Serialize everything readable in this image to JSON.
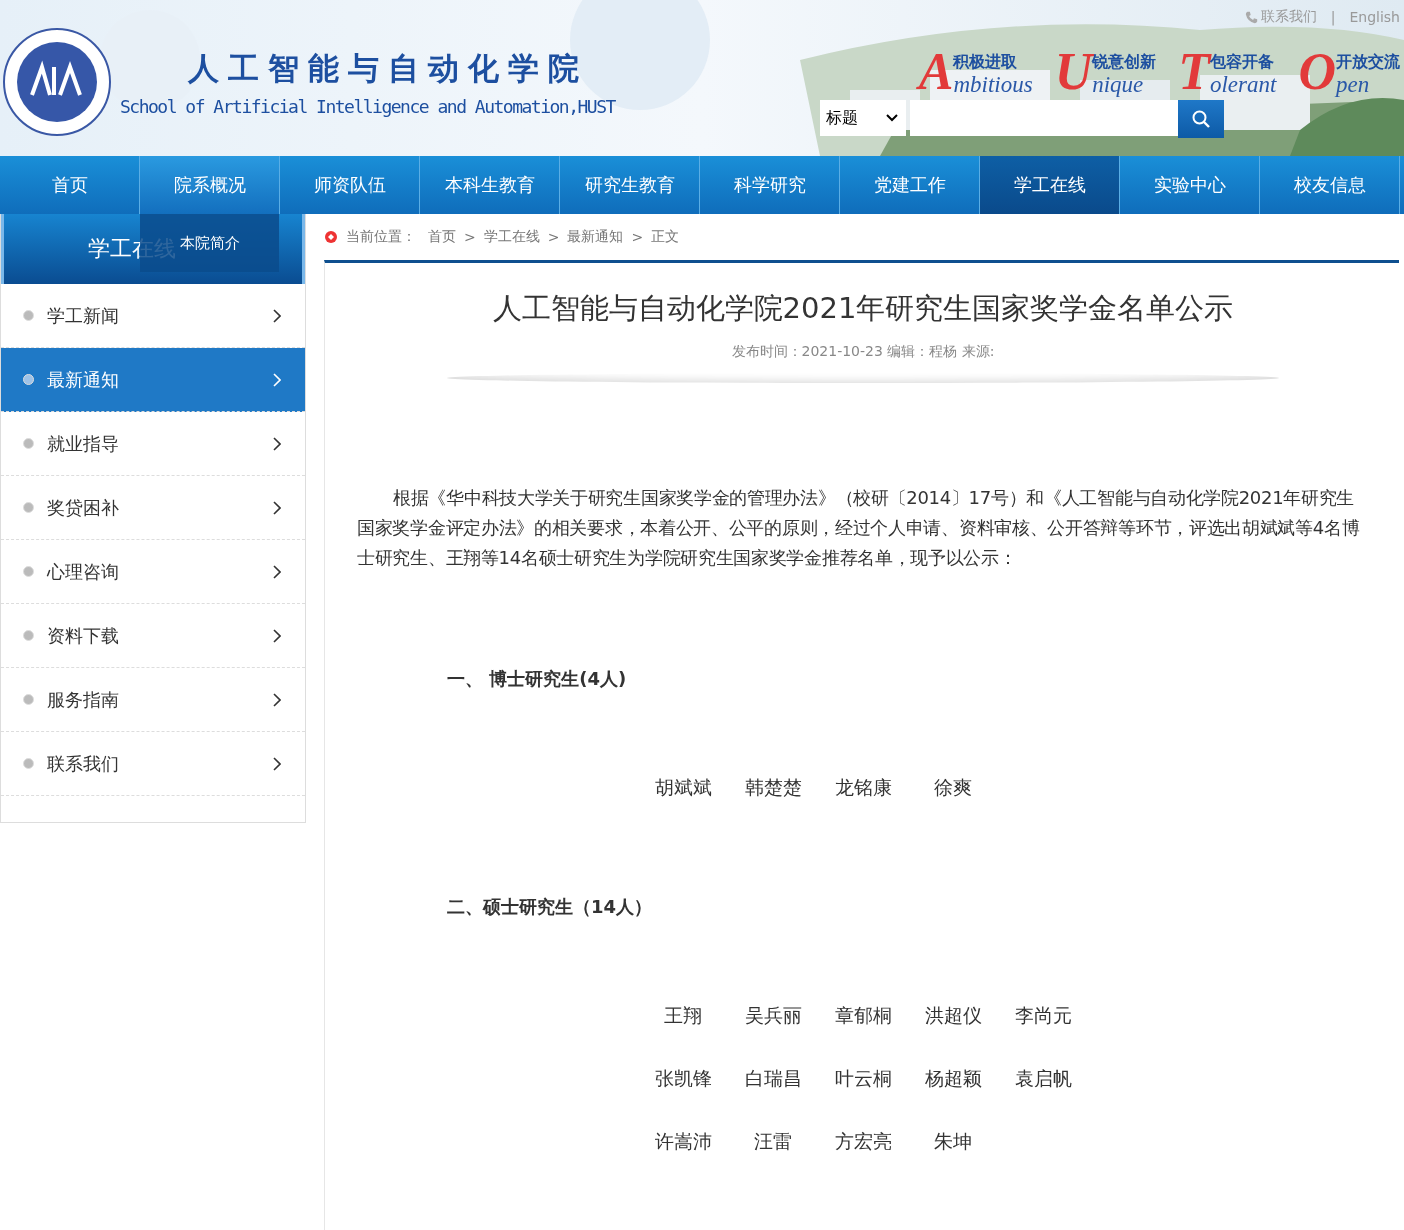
{
  "top_links": [
    {
      "kind": "phone",
      "label": "联系我们"
    },
    {
      "kind": "plain",
      "label": "English"
    }
  ],
  "top_separator": "|",
  "school": {
    "name_cn": "人工智能与自动化学院",
    "name_en": "School of Artificial Intelligence and Automation,HUST"
  },
  "mottos": [
    {
      "letter": "A",
      "cn": "积极进取",
      "en": "mbitious"
    },
    {
      "letter": "U",
      "cn": "锐意创新",
      "en": "nique"
    },
    {
      "letter": "T",
      "cn": "包容开备",
      "en": "olerant"
    },
    {
      "letter": "O",
      "cn": "开放交流",
      "en": "pen"
    }
  ],
  "search": {
    "scope": "标题"
  },
  "nav": [
    {
      "label": "首页",
      "selected": false,
      "hovered": false
    },
    {
      "label": "院系概况",
      "selected": false,
      "hovered": true,
      "submenu": [
        "本院简介"
      ]
    },
    {
      "label": "师资队伍",
      "selected": false,
      "hovered": false
    },
    {
      "label": "本科生教育",
      "selected": false,
      "hovered": false
    },
    {
      "label": "研究生教育",
      "selected": false,
      "hovered": false
    },
    {
      "label": "科学研究",
      "selected": false,
      "hovered": false
    },
    {
      "label": "党建工作",
      "selected": false,
      "hovered": false
    },
    {
      "label": "学工在线",
      "selected": true,
      "hovered": false
    },
    {
      "label": "实验中心",
      "selected": false,
      "hovered": false
    },
    {
      "label": "校友信息",
      "selected": false,
      "hovered": false
    }
  ],
  "sidebar": {
    "title": "学工在线",
    "items": [
      {
        "label": "学工新闻",
        "selected": false
      },
      {
        "label": "最新通知",
        "selected": true
      },
      {
        "label": "就业指导",
        "selected": false
      },
      {
        "label": "奖贷困补",
        "selected": false
      },
      {
        "label": "心理咨询",
        "selected": false
      },
      {
        "label": "资料下载",
        "selected": false
      },
      {
        "label": "服务指南",
        "selected": false
      },
      {
        "label": "联系我们",
        "selected": false
      }
    ]
  },
  "breadcrumb": {
    "label": "当前位置：",
    "path": [
      "首页",
      "学工在线",
      "最新通知",
      "正文"
    ],
    "separator": ">"
  },
  "article": {
    "title": "人工智能与自动化学院2021年研究生国家奖学金名单公示",
    "meta": "发布时间：2021-10-23 编辑：程杨 来源:",
    "intro": "根据《华中科技大学关于研究生国家奖学金的管理办法》（校研〔2014〕17号）和《人工智能与自动化学院2021年研究生国家奖学金评定办法》的相关要求，本着公开、公平的原则，经过个人申请、资料审核、公开答辩等环节，评选出胡斌斌等4名博士研究生、王翔等14名硕士研究生为学院研究生国家奖学金推荐名单，现予以公示：",
    "sections": [
      {
        "heading": "一、 博士研究生(4人)",
        "names": [
          "胡斌斌",
          "韩楚楚",
          "龙铭康",
          "徐爽"
        ]
      },
      {
        "heading": "二、硕士研究生（14人）",
        "names": [
          "王翔",
          "吴兵丽",
          "章郁桐",
          "洪超仪",
          "李尚元",
          "张凯锋",
          "白瑞昌",
          "叶云桐",
          "杨超颖",
          "袁启帆",
          "许嵩沛",
          "汪雷",
          "方宏亮",
          "朱坤"
        ]
      }
    ]
  }
}
